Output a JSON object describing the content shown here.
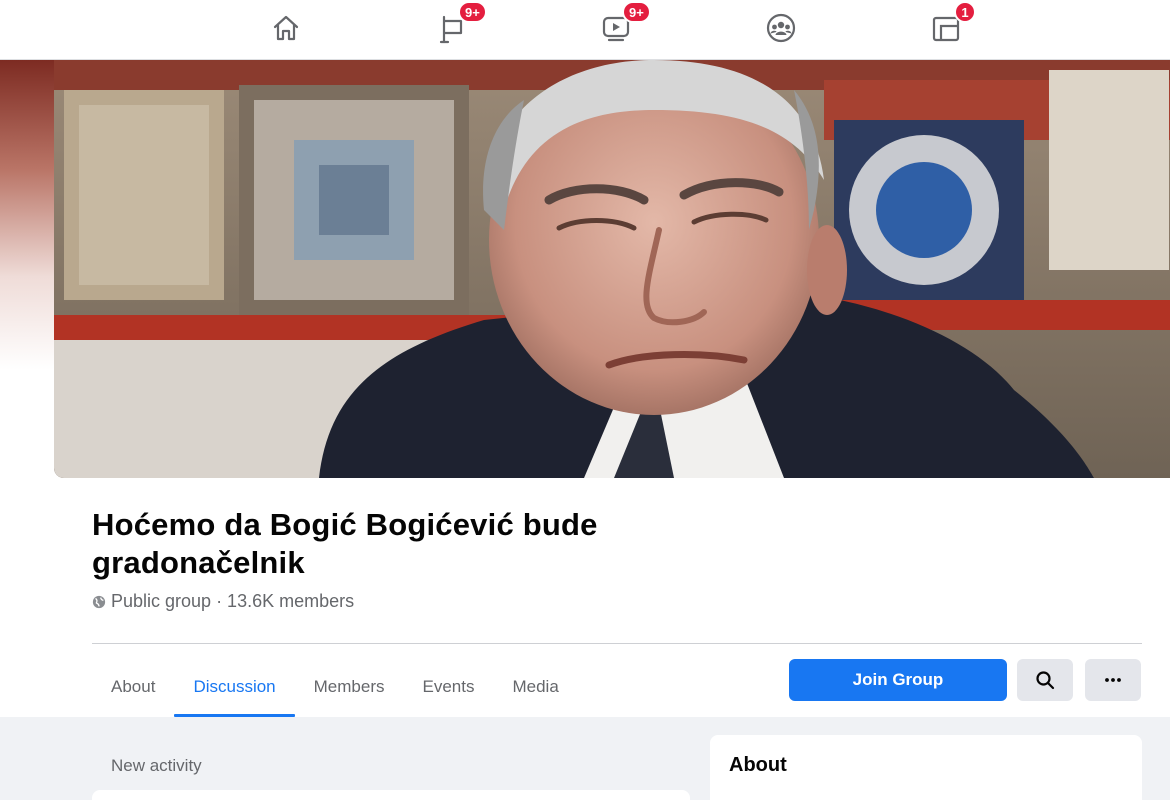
{
  "topnav": {
    "items": [
      {
        "name": "home",
        "icon": "home-icon",
        "badge": ""
      },
      {
        "name": "pages",
        "icon": "flag-icon",
        "badge": "9+"
      },
      {
        "name": "watch",
        "icon": "video-icon",
        "badge": "9+"
      },
      {
        "name": "groups",
        "icon": "groups-icon",
        "badge": ""
      },
      {
        "name": "gaming",
        "icon": "gaming-icon",
        "badge": "1"
      }
    ]
  },
  "group": {
    "title": "Hoćemo da Bogić Bogićević bude gradonačelnik",
    "privacy_icon": "globe-icon",
    "meta": "Public group · 13.6K members"
  },
  "tabs": [
    {
      "label": "About",
      "active": false
    },
    {
      "label": "Discussion",
      "active": true
    },
    {
      "label": "Members",
      "active": false
    },
    {
      "label": "Events",
      "active": false
    },
    {
      "label": "Media",
      "active": false
    }
  ],
  "actions": {
    "join_label": "Join Group",
    "search_icon": "search-icon",
    "more_icon": "more-icon"
  },
  "feed": {
    "new_activity_label": "New activity"
  },
  "about_card": {
    "title": "About"
  },
  "colors": {
    "accent": "#1877f2",
    "badge": "#e41e3f",
    "muted_text": "#65676b",
    "page_bg": "#f0f2f5"
  }
}
